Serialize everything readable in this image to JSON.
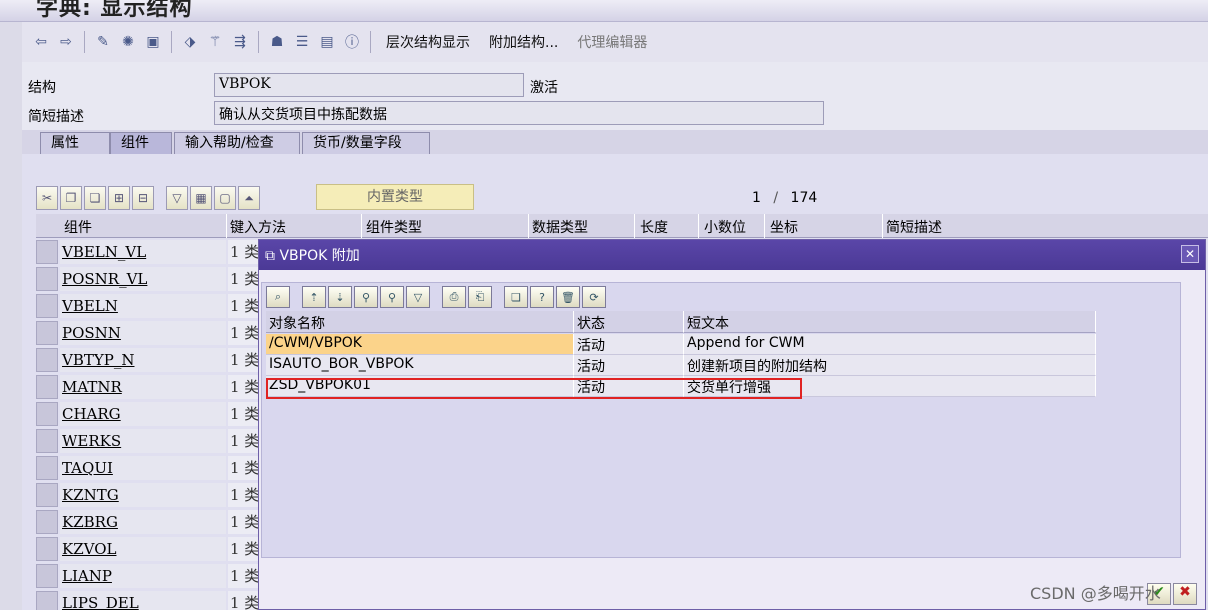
{
  "window_title": "字典: 显示结构",
  "toolbar": {
    "text_buttons": [
      "层次结构显示",
      "附加结构...",
      "代理编辑器"
    ]
  },
  "form": {
    "structure_label": "结构",
    "structure_value": "VBPOK",
    "status": "激活",
    "short_desc_label": "简短描述",
    "short_desc_value": "确认从交货项目中拣配数据"
  },
  "tabs": [
    "属性",
    "组件",
    "输入帮助/检查",
    "货币/数量字段"
  ],
  "active_tab": "组件",
  "grid": {
    "builtin_type_button": "内置类型",
    "pager": {
      "current": "1",
      "sep": "/",
      "total": "174"
    },
    "columns": [
      "组件",
      "键入方法",
      "组件类型",
      "数据类型",
      "长度",
      "小数位",
      "坐标",
      "简短描述"
    ],
    "rows": [
      {
        "component": "VBELN_VL",
        "method": "1 类"
      },
      {
        "component": "POSNR_VL",
        "method": "1 类"
      },
      {
        "component": "VBELN",
        "method": "1 类"
      },
      {
        "component": "POSNN",
        "method": "1 类"
      },
      {
        "component": "VBTYP_N",
        "method": "1 类"
      },
      {
        "component": "MATNR",
        "method": "1 类"
      },
      {
        "component": "CHARG",
        "method": "1 类"
      },
      {
        "component": "WERKS",
        "method": "1 类"
      },
      {
        "component": "TAQUI",
        "method": "1 类"
      },
      {
        "component": "KZNTG",
        "method": "1 类"
      },
      {
        "component": "KZBRG",
        "method": "1 类"
      },
      {
        "component": "KZVOL",
        "method": "1 类"
      },
      {
        "component": "LIANP",
        "method": "1 类"
      },
      {
        "component": "LIPS_DEL",
        "method": "1 类"
      }
    ]
  },
  "dialog": {
    "title": "VBPOK 附加",
    "columns": [
      "对象名称",
      "状态",
      "短文本"
    ],
    "rows": [
      {
        "name": "/CWM/VBPOK",
        "status": "活动",
        "text": "Append for CWM"
      },
      {
        "name": "ISAUTO_BOR_VBPOK",
        "status": "活动",
        "text": "创建新项目的附加结构"
      },
      {
        "name": "ZSD_VBPOK01",
        "status": "活动",
        "text": "交货单行增强"
      }
    ],
    "highlighted_row_color": "#fbd38a",
    "annotation_color": "#e02323"
  },
  "watermark": "CSDN @多喝开水"
}
